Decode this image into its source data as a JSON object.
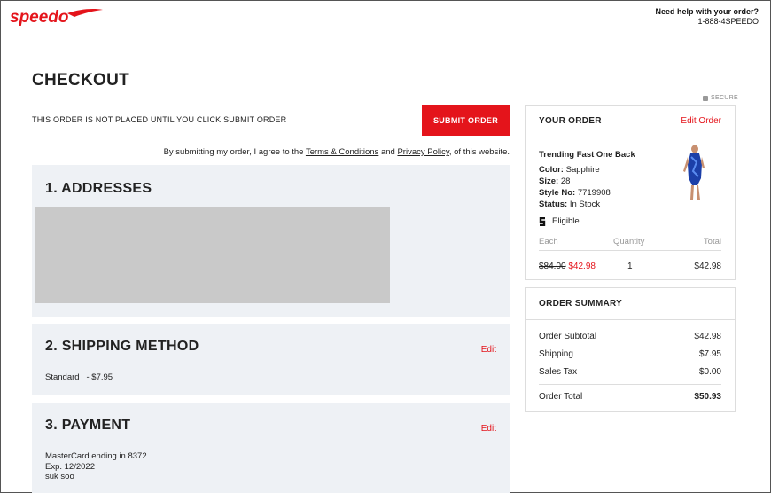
{
  "header": {
    "brand": "speedo",
    "help_title": "Need help with your order?",
    "help_phone": "1-888-4SPEEDO"
  },
  "checkout": {
    "title": "CHECKOUT",
    "notice": "THIS ORDER IS NOT PLACED UNTIL YOU CLICK SUBMIT ORDER",
    "submit_label": "SUBMIT ORDER",
    "agree_prefix": "By submitting my order, I agree to the",
    "terms_link": "Terms & Conditions",
    "agree_and": "and",
    "privacy_link": "Privacy Policy",
    "agree_suffix": ", of this website."
  },
  "sections": {
    "addresses": {
      "title": "1. ADDRESSES"
    },
    "shipping": {
      "title": "2. SHIPPING METHOD",
      "edit": "Edit",
      "method": "Standard",
      "price": "- $7.95"
    },
    "payment": {
      "title": "3. PAYMENT",
      "edit": "Edit",
      "card": "MasterCard ending in 8372",
      "exp": "Exp. 12/2022",
      "name": "suk soo"
    }
  },
  "order": {
    "secure_label": "SECURE",
    "heading": "YOUR ORDER",
    "edit_label": "Edit Order",
    "product": {
      "name": "Trending Fast One Back",
      "color_label": "Color:",
      "color": "Sapphire",
      "size_label": "Size:",
      "size": "28",
      "style_label": "Style No:",
      "style": "7719908",
      "status_label": "Status:",
      "status": "In Stock",
      "eligible": "Eligible"
    },
    "columns": {
      "each": "Each",
      "quantity": "Quantity",
      "total": "Total"
    },
    "line": {
      "original": "$84.00",
      "sale": "$42.98",
      "qty": "1",
      "total": "$42.98"
    }
  },
  "summary": {
    "heading": "ORDER SUMMARY",
    "rows": [
      {
        "label": "Order Subtotal",
        "value": "$42.98"
      },
      {
        "label": "Shipping",
        "value": "$7.95"
      },
      {
        "label": "Sales Tax",
        "value": "$0.00"
      }
    ],
    "total_label": "Order Total",
    "total_value": "$50.93"
  },
  "colors": {
    "accent": "#e4141b",
    "section_bg": "#eef1f5",
    "placeholder": "#c9c9c9"
  }
}
